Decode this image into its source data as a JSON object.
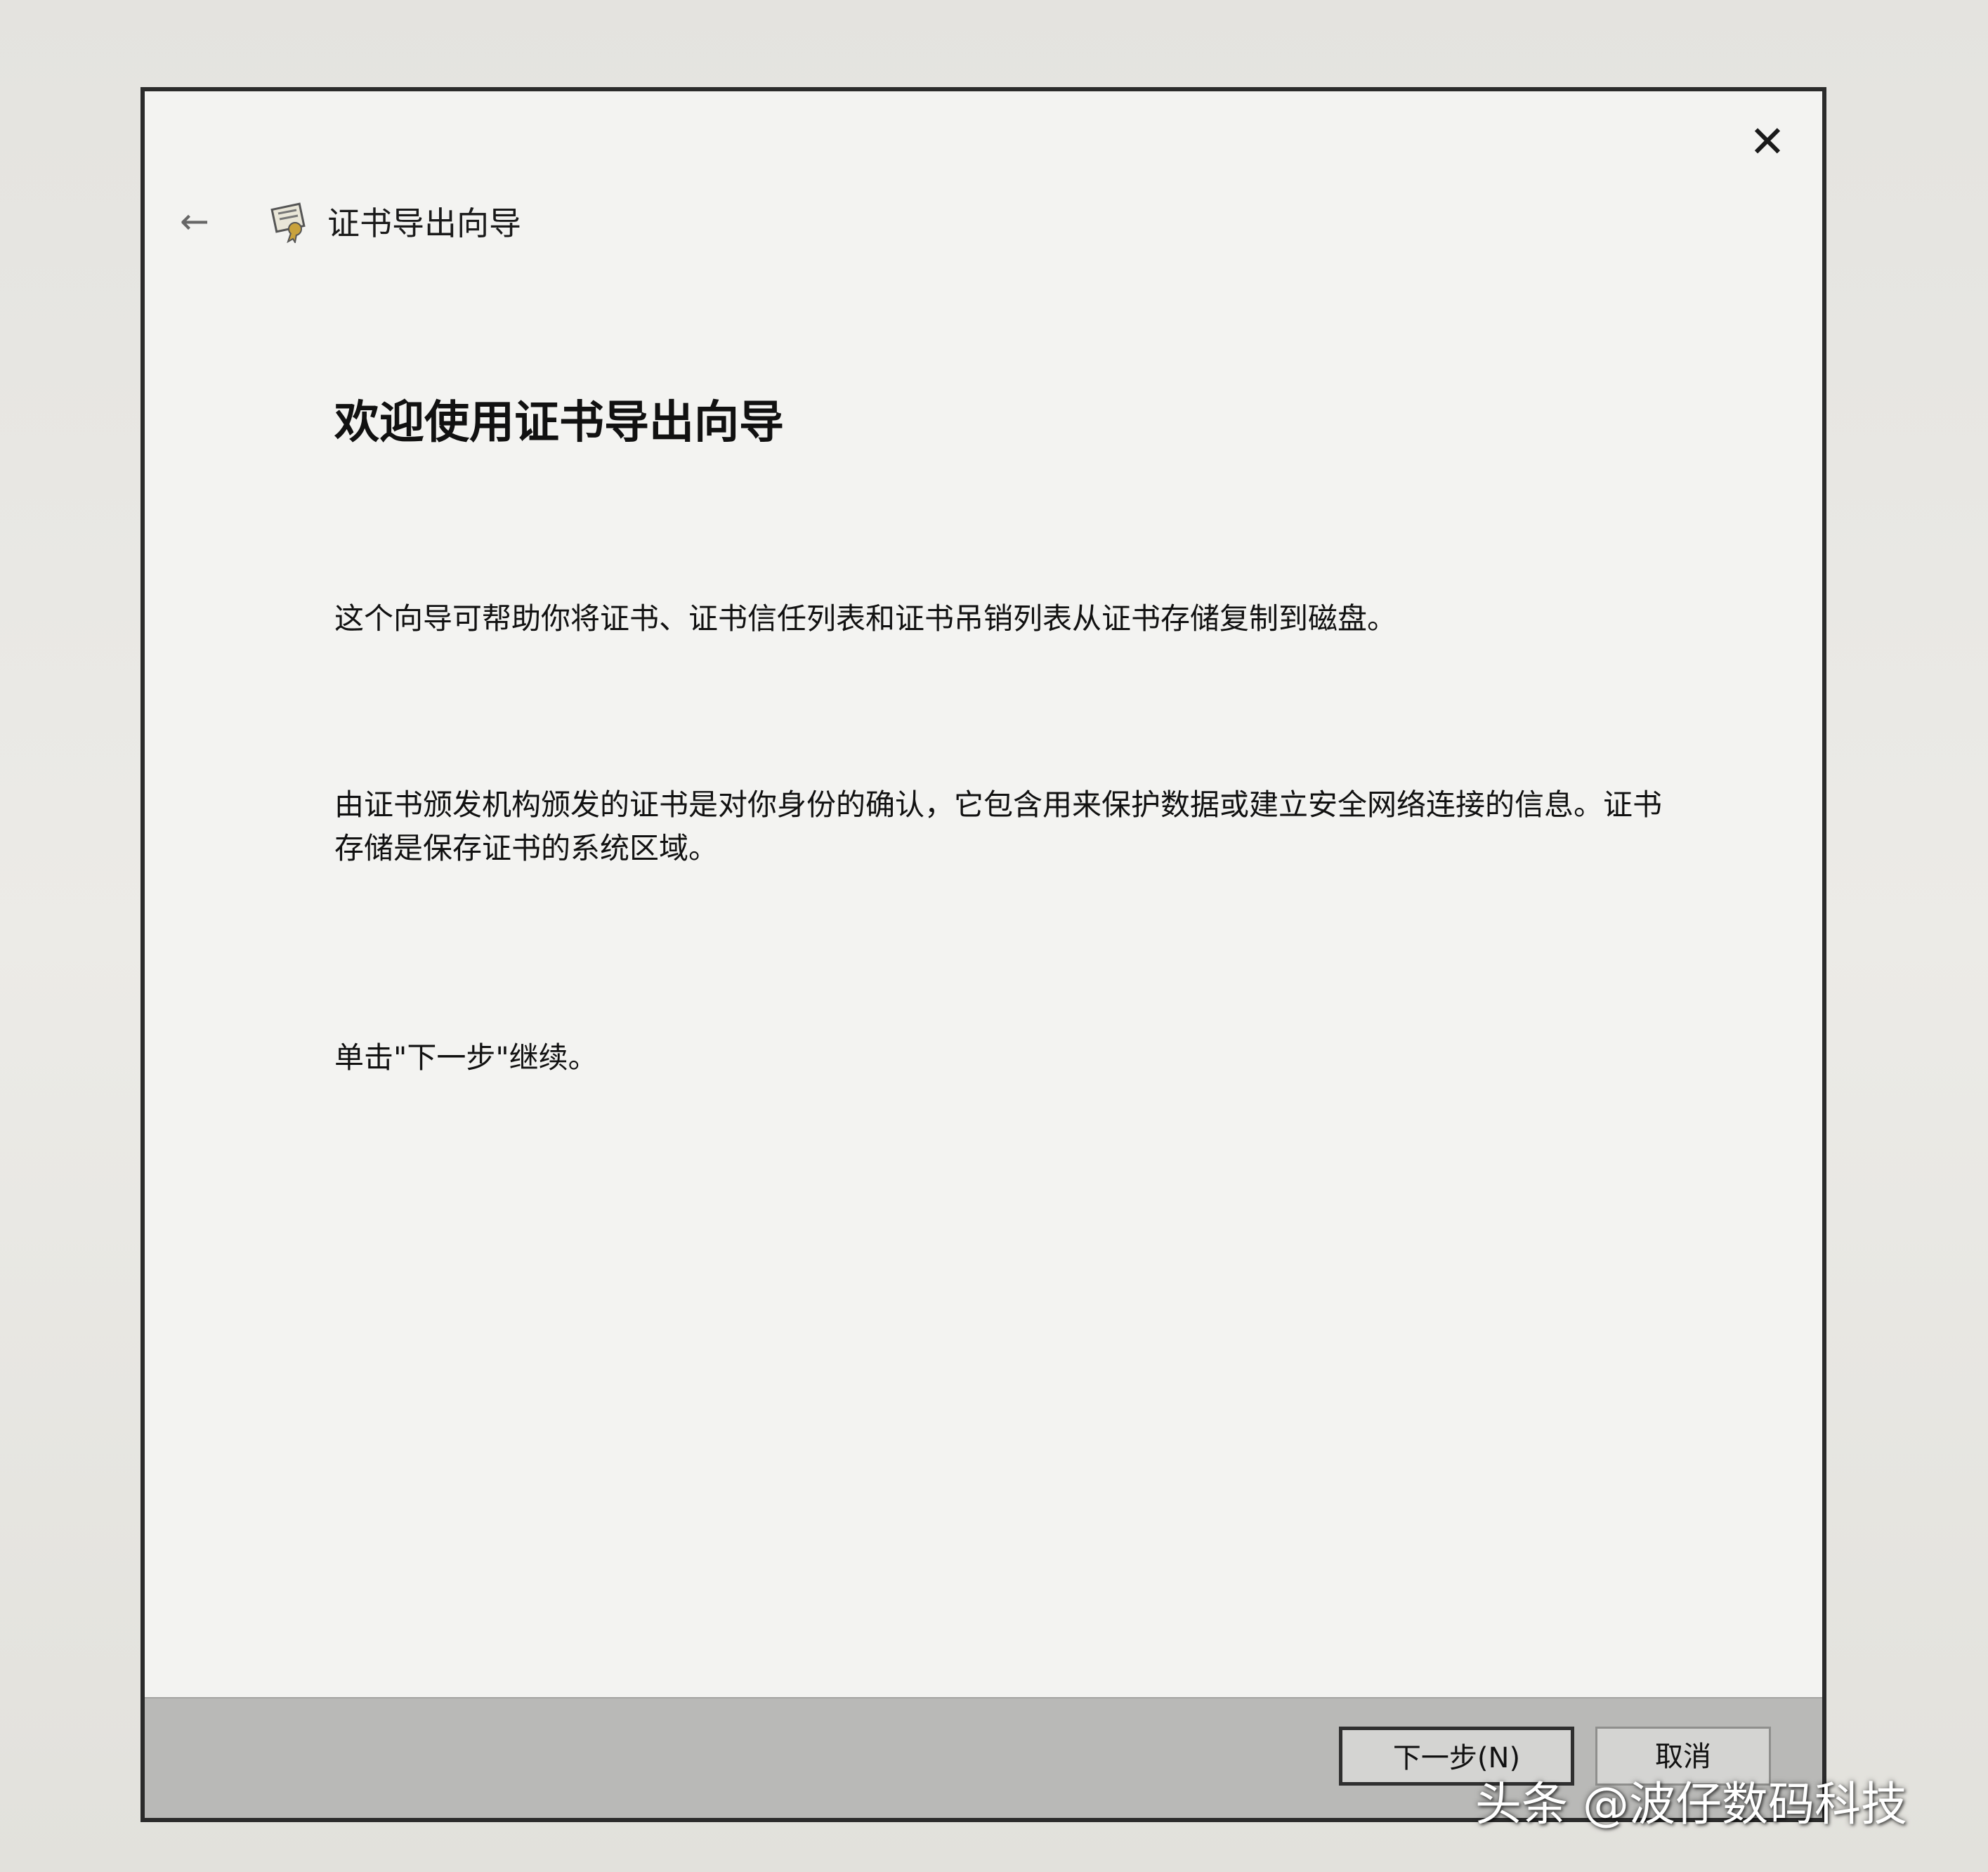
{
  "dialog": {
    "close_glyph": "✕",
    "back_glyph": "←",
    "header_title": "证书导出向导",
    "welcome_title": "欢迎使用证书导出向导",
    "paragraphs": [
      "这个向导可帮助你将证书、证书信任列表和证书吊销列表从证书存储复制到磁盘。",
      "由证书颁发机构颁发的证书是对你身份的确认，它包含用来保护数据或建立安全网络连接的信息。证书存储是保存证书的系统区域。",
      "单击\"下一步\"继续。"
    ],
    "buttons": {
      "next": "下一步(N)",
      "cancel": "取消"
    },
    "icons": {
      "back": "back-arrow-icon",
      "certificate": "certificate-icon",
      "close": "close-icon"
    }
  },
  "watermark": "头条 @波仔数码科技"
}
